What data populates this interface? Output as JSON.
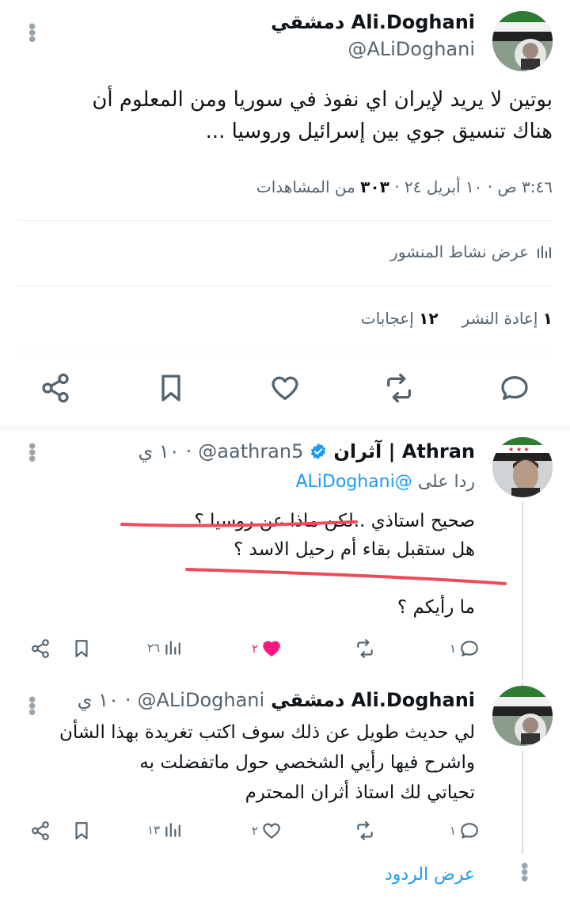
{
  "main_tweet": {
    "display_name": "Ali.Doghani دمشقي",
    "handle": "@ALiDoghani",
    "text_line1": "بوتين لا يريد لإيران اي نفوذ في سوريا ومن المعلوم أن",
    "text_line2": "هناك تنسيق جوي بين إسرائيل وروسيا ...",
    "meta_time": "٣:٤٦ ص · ١٠ أبريل ٢٤ ·",
    "meta_views_count": "٣٠٣",
    "meta_views_label": "من المشاهدات",
    "activity_label": "عرض نشاط المنشور",
    "reposts_count": "١",
    "reposts_label": "إعادة النشر",
    "likes_count": "١٢",
    "likes_label": "إعجابات"
  },
  "reply1": {
    "display_name": "آثران | Athran",
    "handle": "@aathran5",
    "time": "١٠ ي",
    "replying_to_label": "ردا على",
    "replying_to_handle": "@ALiDoghani",
    "line1": "صحيح استاذي ..لكن ماذا عن روسيا ؟",
    "line2": "هل ستقبل بقاء أم رحيل الاسد ؟",
    "line3": "ما رأيكم ؟",
    "replies": "١",
    "likes": "٢",
    "views": "٢٦"
  },
  "reply2": {
    "display_name": "Ali.Doghani دمشقي",
    "handle": "@ALiDoghani",
    "time": "١٠ ي",
    "line1": "لي حديث طويل عن ذلك سوف اكتب تغريدة بهذا الشأن",
    "line2": "واشرح فيها رأيي الشخصي حول ماتفضلت به",
    "line3": "تحياتي لك استاذ أثران المحترم",
    "replies": "١",
    "likes": "٢",
    "views": "١٣"
  },
  "show_replies_label": "عرض الردود",
  "colors": {
    "text": "#0f1419",
    "muted": "#536471",
    "link": "#1d9bf0",
    "like_active": "#f91880",
    "underline_red": "#f04a5a"
  },
  "icons": [
    "more-icon",
    "chart-icon",
    "share-icon",
    "bookmark-icon",
    "heart-icon",
    "repost-icon",
    "reply-icon",
    "verified-icon"
  ]
}
